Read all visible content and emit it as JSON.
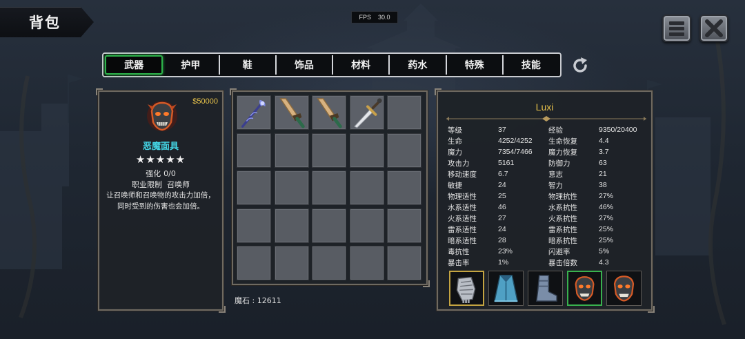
{
  "header": {
    "title": "背包"
  },
  "fps": {
    "label": "FPS",
    "value": "30.0"
  },
  "tabs": [
    {
      "label": "武器",
      "active": true
    },
    {
      "label": "护甲",
      "active": false
    },
    {
      "label": "鞋",
      "active": false
    },
    {
      "label": "饰品",
      "active": false
    },
    {
      "label": "材料",
      "active": false
    },
    {
      "label": "药水",
      "active": false
    },
    {
      "label": "特殊",
      "active": false
    },
    {
      "label": "技能",
      "active": false
    }
  ],
  "item_detail": {
    "icon": "demon-mask-icon",
    "price": "$50000",
    "name": "恶魔面具",
    "stars": "★★★★★",
    "star_count": 5,
    "enhance_label": "强化",
    "enhance_value": "0/0",
    "job_label": "职业限制",
    "job_value": "召唤师",
    "description_line1": "让召唤师和召唤物的攻击力加倍，",
    "description_line2": "同时受到的伤害也会加倍。"
  },
  "inventory": {
    "rows": 5,
    "cols": 5,
    "items": [
      {
        "slot": 0,
        "icon": "magic-staff-icon"
      },
      {
        "slot": 1,
        "icon": "wooden-sword-icon"
      },
      {
        "slot": 2,
        "icon": "wooden-sword-icon"
      },
      {
        "slot": 3,
        "icon": "steel-sword-icon"
      }
    ]
  },
  "currency": {
    "text": "魔石 : 12611"
  },
  "character": {
    "name": "Luxi",
    "stats": [
      [
        "等级",
        "37",
        "经验",
        "9350/20400"
      ],
      [
        "生命",
        "4252/4252",
        "生命恢复",
        "4.4"
      ],
      [
        "魔力",
        "7354/7466",
        "魔力恢复",
        "3.7"
      ],
      [
        "攻击力",
        "5161",
        "防御力",
        "63"
      ],
      [
        "移动速度",
        "6.7",
        "意志",
        "21"
      ],
      [
        "敏捷",
        "24",
        "智力",
        "38"
      ],
      [
        "物理适性",
        "25",
        "物理抗性",
        "27%"
      ],
      [
        "水系适性",
        "46",
        "水系抗性",
        "46%"
      ],
      [
        "火系适性",
        "27",
        "火系抗性",
        "27%"
      ],
      [
        "雷系适性",
        "24",
        "雷系抗性",
        "25%"
      ],
      [
        "暗系适性",
        "28",
        "暗系抗性",
        "25%"
      ],
      [
        "毒抗性",
        "23%",
        "闪避率",
        "5%"
      ],
      [
        "暴击率",
        "1%",
        "暴击倍数",
        "4.3"
      ]
    ],
    "equipment": [
      {
        "icon": "gauntlet-icon",
        "frame": "gold"
      },
      {
        "icon": "blue-robe-icon",
        "frame": "plain"
      },
      {
        "icon": "boots-icon",
        "frame": "plain"
      },
      {
        "icon": "demon-mask-icon",
        "frame": "green"
      },
      {
        "icon": "demon-mask-icon",
        "frame": "plain"
      }
    ]
  },
  "colors": {
    "active_tab": "#2db24a",
    "item_name": "#44d6e6",
    "gold_text": "#e7c24a"
  }
}
